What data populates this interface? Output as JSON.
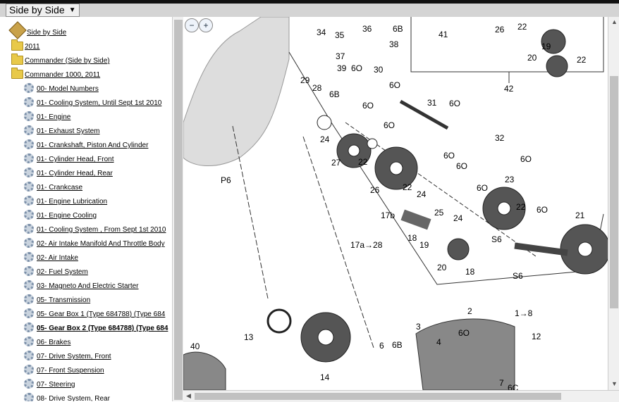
{
  "header": {
    "selector_value": "Side by Side"
  },
  "tree": {
    "items": [
      {
        "label": "Side by Side",
        "level": "root",
        "icon": "root-icon"
      },
      {
        "label": "2011",
        "level": "folder",
        "icon": "folder-icon"
      },
      {
        "label": "Commander (Side by Side)",
        "level": "folder",
        "icon": "folder-icon"
      },
      {
        "label": "Commander 1000, 2011",
        "level": "folder",
        "icon": "folder-icon"
      },
      {
        "label": "00- Model Numbers",
        "level": "leaf",
        "icon": "gear-icon"
      },
      {
        "label": "01- Cooling System, Until Sept 1st 2010",
        "level": "leaf",
        "icon": "gear-icon"
      },
      {
        "label": "01- Engine",
        "level": "leaf",
        "icon": "gear-icon"
      },
      {
        "label": "01- Exhaust System",
        "level": "leaf",
        "icon": "gear-icon"
      },
      {
        "label": "01- Crankshaft, Piston And Cylinder",
        "level": "leaf",
        "icon": "gear-icon"
      },
      {
        "label": "01- Cylinder Head, Front",
        "level": "leaf",
        "icon": "gear-icon"
      },
      {
        "label": "01- Cylinder Head, Rear",
        "level": "leaf",
        "icon": "gear-icon"
      },
      {
        "label": "01- Crankcase",
        "level": "leaf",
        "icon": "gear-icon"
      },
      {
        "label": "01- Engine Lubrication",
        "level": "leaf",
        "icon": "gear-icon"
      },
      {
        "label": "01- Engine Cooling",
        "level": "leaf",
        "icon": "gear-icon"
      },
      {
        "label": "01- Cooling System , From Sept 1st 2010",
        "level": "leaf",
        "icon": "gear-icon"
      },
      {
        "label": "02- Air Intake Manifold And Throttle Body",
        "level": "leaf",
        "icon": "gear-icon"
      },
      {
        "label": "02- Air Intake",
        "level": "leaf",
        "icon": "gear-icon"
      },
      {
        "label": "02- Fuel System",
        "level": "leaf",
        "icon": "gear-icon"
      },
      {
        "label": "03- Magneto And Electric Starter",
        "level": "leaf",
        "icon": "gear-icon"
      },
      {
        "label": "05- Transmission",
        "level": "leaf",
        "icon": "gear-icon"
      },
      {
        "label": "05- Gear Box 1  (Type 684788) (Type 684",
        "level": "leaf",
        "icon": "gear-icon"
      },
      {
        "label": "05- Gear Box 2  (Type 684788) (Type 684",
        "level": "leaf",
        "icon": "gear-icon",
        "selected": true
      },
      {
        "label": "06- Brakes",
        "level": "leaf",
        "icon": "gear-icon"
      },
      {
        "label": "07- Drive System, Front",
        "level": "leaf",
        "icon": "gear-icon"
      },
      {
        "label": "07- Front Suspension",
        "level": "leaf",
        "icon": "gear-icon"
      },
      {
        "label": "07- Steering",
        "level": "leaf",
        "icon": "gear-icon"
      },
      {
        "label": "08- Drive System, Rear",
        "level": "leaf",
        "icon": "gear-icon"
      }
    ]
  },
  "viewer": {
    "zoom_out_label": "−",
    "zoom_in_label": "+",
    "callouts": [
      "34",
      "35",
      "36",
      "6B",
      "38",
      "41",
      "26",
      "22",
      "19",
      "20",
      "22",
      "37",
      "39",
      "30",
      "29",
      "28",
      "6O",
      "6B",
      "6O",
      "24",
      "6O",
      "31",
      "6O",
      "27",
      "22",
      "6O",
      "6O",
      "26",
      "22",
      "24",
      "6O",
      "32",
      "6O",
      "6O",
      "25",
      "24",
      "23",
      "22",
      "6O",
      "17b",
      "17a→28",
      "18",
      "19",
      "20",
      "18",
      "21",
      "S6",
      "S6",
      "P6",
      "13",
      "40",
      "14",
      "6",
      "6B",
      "4",
      "3",
      "2",
      "1→8",
      "12",
      "6O",
      "7",
      "42",
      "6C"
    ]
  }
}
